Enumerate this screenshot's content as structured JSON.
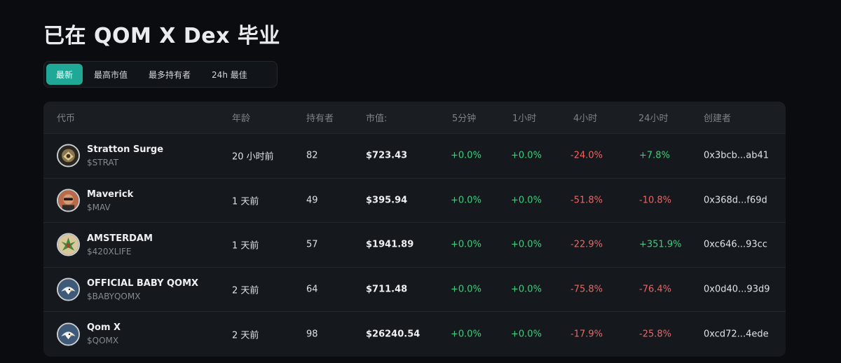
{
  "page": {
    "title": "已在 QOM X Dex 毕业"
  },
  "tabs": [
    {
      "label": "最新",
      "active": true
    },
    {
      "label": "最高市值",
      "active": false
    },
    {
      "label": "最多持有者",
      "active": false
    },
    {
      "label": "24h 最佳",
      "active": false
    }
  ],
  "table": {
    "headers": {
      "token": "代币",
      "age": "年龄",
      "holders": "持有者",
      "mcap": "市值:",
      "m5": "5分钟",
      "h1": "1小时",
      "h4": "4小时",
      "h24": "24小时",
      "creator": "创建者"
    },
    "rows": [
      {
        "name": "Stratton Surge",
        "symbol": "$STRAT",
        "age": "20 小时前",
        "holders": "82",
        "mcap": "$723.43",
        "m5": "+0.0%",
        "h1": "+0.0%",
        "h4": "-24.0%",
        "h24": "+7.8%",
        "creator": "0x3bcb...ab41",
        "avatar_icon": "art-avatar-icon"
      },
      {
        "name": "Maverick",
        "symbol": "$MAV",
        "age": "1 天前",
        "holders": "49",
        "mcap": "$395.94",
        "m5": "+0.0%",
        "h1": "+0.0%",
        "h4": "-51.8%",
        "h24": "-10.8%",
        "creator": "0x368d...f69d",
        "avatar_icon": "face-avatar-icon"
      },
      {
        "name": "AMSTERDAM",
        "symbol": "$420XLIFE",
        "age": "1 天前",
        "holders": "57",
        "mcap": "$1941.89",
        "m5": "+0.0%",
        "h1": "+0.0%",
        "h4": "-22.9%",
        "h24": "+351.9%",
        "creator": "0xc646...93cc",
        "avatar_icon": "leaf-avatar-icon"
      },
      {
        "name": "OFFICIAL BABY QOMX",
        "symbol": "$BABYQOMX",
        "age": "2 天前",
        "holders": "64",
        "mcap": "$711.48",
        "m5": "+0.0%",
        "h1": "+0.0%",
        "h4": "-75.8%",
        "h24": "-76.4%",
        "creator": "0x0d40...93d9",
        "avatar_icon": "eagle-avatar-icon"
      },
      {
        "name": "Qom X",
        "symbol": "$QOMX",
        "age": "2 天前",
        "holders": "98",
        "mcap": "$26240.54",
        "m5": "+0.0%",
        "h1": "+0.0%",
        "h4": "-17.9%",
        "h24": "-25.8%",
        "creator": "0xcd72...4ede",
        "avatar_icon": "eagle-avatar-icon"
      }
    ]
  },
  "colors": {
    "accent": "#1ea895",
    "positive": "#3ccf7c",
    "negative": "#f06464"
  }
}
